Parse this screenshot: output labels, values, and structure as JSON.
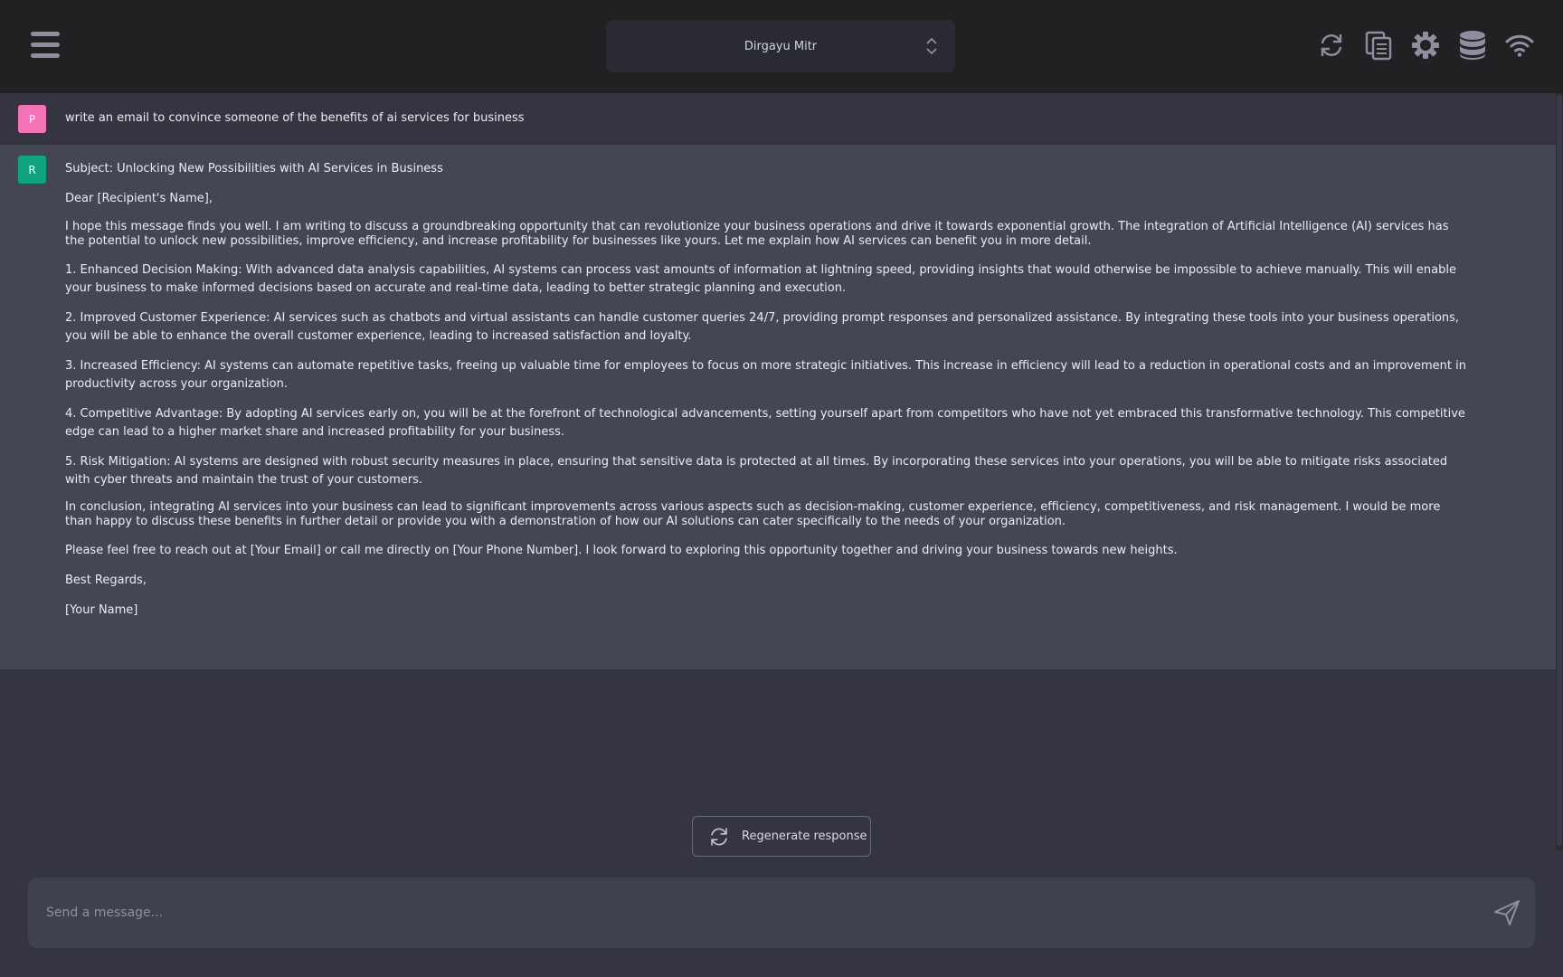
{
  "header": {
    "model_name": "Dirgayu Mitr",
    "icons": [
      "menu-icon",
      "refresh-icon",
      "copy-icon",
      "settings-gear-icon",
      "database-icon",
      "wifi-icon"
    ]
  },
  "conversation": {
    "user": {
      "avatar_letter": "P",
      "avatar_color": "#f472b6",
      "text": "write an email to convince someone of the benefits of ai services for business"
    },
    "assistant": {
      "avatar_letter": "R",
      "avatar_color": "#10a37f",
      "paragraphs": [
        "Subject: Unlocking New Possibilities with AI Services in Business",
        "Dear [Recipient's Name],",
        "I hope this message finds you well. I am writing to discuss a groundbreaking opportunity that can revolutionize your business operations and drive it towards exponential growth. The integration of Artificial Intelligence (AI) services has the potential to unlock new possibilities, improve efficiency, and increase profitability for businesses like yours. Let me explain how AI services can benefit you in more detail.",
        "1. Enhanced Decision Making: With advanced data analysis capabilities, AI systems can process vast amounts of information at lightning speed, providing insights that would otherwise be impossible to achieve manually. This will enable your business to make informed decisions based on accurate and real-time data, leading to better strategic planning and execution.",
        "2. Improved Customer Experience: AI services such as chatbots and virtual assistants can handle customer queries 24/7, providing prompt responses and personalized assistance. By integrating these tools into your business operations, you will be able to enhance the overall customer experience, leading to increased satisfaction and loyalty.",
        "3. Increased Efficiency: AI systems can automate repetitive tasks, freeing up valuable time for employees to focus on more strategic initiatives. This increase in efficiency will lead to a reduction in operational costs and an improvement in productivity across your organization.",
        "4. Competitive Advantage: By adopting AI services early on, you will be at the forefront of technological advancements, setting yourself apart from competitors who have not yet embraced this transformative technology. This competitive edge can lead to a higher market share and increased profitability for your business.",
        "5. Risk Mitigation: AI systems are designed with robust security measures in place, ensuring that sensitive data is protected at all times. By incorporating these services into your operations, you will be able to mitigate risks associated with cyber threats and maintain the trust of your customers.",
        "In conclusion, integrating AI services into your business can lead to significant improvements across various aspects such as decision-making, customer experience, efficiency, competitiveness, and risk management. I would be more than happy to discuss these benefits in further detail or provide you with a demonstration of how our AI solutions can cater specifically to the needs of your organization.",
        "Please feel free to reach out at [Your Email] or call me directly on [Your Phone Number]. I look forward to exploring this opportunity together and driving your business towards new heights.",
        "Best Regards,",
        "[Your Name]"
      ]
    }
  },
  "actions": {
    "regenerate_label": "Regenerate response"
  },
  "composer": {
    "placeholder": "Send a message...",
    "value": ""
  }
}
